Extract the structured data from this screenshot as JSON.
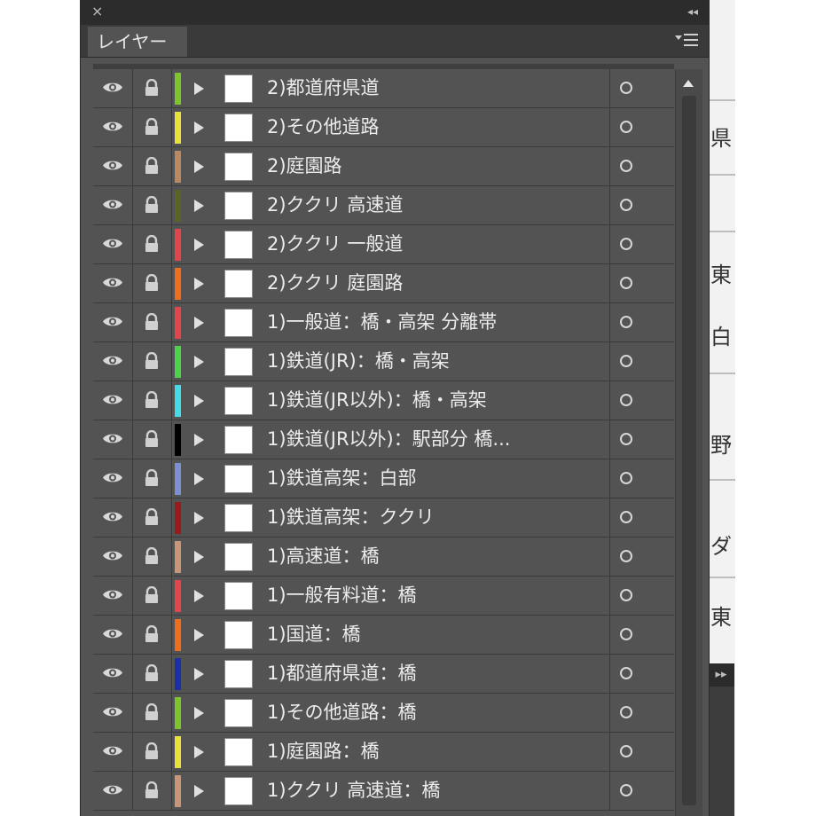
{
  "panel": {
    "title": "レイヤー",
    "close_glyph": "×",
    "collapse_glyph": "◂◂"
  },
  "side_panel": {
    "expand_glyph": "▸▸"
  },
  "map_fragment": {
    "chars": [
      "県",
      "東",
      "白",
      "野",
      "ダ",
      "東"
    ]
  },
  "layers": [
    {
      "name": "2)都道府県道",
      "color": "#7dc32c"
    },
    {
      "name": "2)その他道路",
      "color": "#e8e23a"
    },
    {
      "name": "2)庭園路",
      "color": "#b98a62"
    },
    {
      "name": "2)ククリ 高速道",
      "color": "#5b6426"
    },
    {
      "name": "2)ククリ 一般道",
      "color": "#e2464c"
    },
    {
      "name": "2)ククリ 庭園路",
      "color": "#ef6d1b"
    },
    {
      "name": "1)一般道：橋・高架 分離帯",
      "color": "#e2464c"
    },
    {
      "name": "1)鉄道(JR)：橋・高架",
      "color": "#4bd24b"
    },
    {
      "name": "1)鉄道(JR以外)：橋・高架",
      "color": "#43dbe6"
    },
    {
      "name": "1)鉄道(JR以外)：駅部分 橋...",
      "color": "#000000"
    },
    {
      "name": "1)鉄道高架：白部",
      "color": "#7d8fd0"
    },
    {
      "name": "1)鉄道高架：ククリ",
      "color": "#9b1b1b"
    },
    {
      "name": "1)高速道：橋",
      "color": "#c89577"
    },
    {
      "name": "1)一般有料道：橋",
      "color": "#e2464c"
    },
    {
      "name": "1)国道：橋",
      "color": "#ef6d1b"
    },
    {
      "name": "1)都道府県道：橋",
      "color": "#1b2fa8"
    },
    {
      "name": "1)その他道路：橋",
      "color": "#7dc32c"
    },
    {
      "name": "1)庭園路：橋",
      "color": "#e8e23a"
    },
    {
      "name": "1)ククリ 高速道：橋",
      "color": "#c89577"
    }
  ]
}
